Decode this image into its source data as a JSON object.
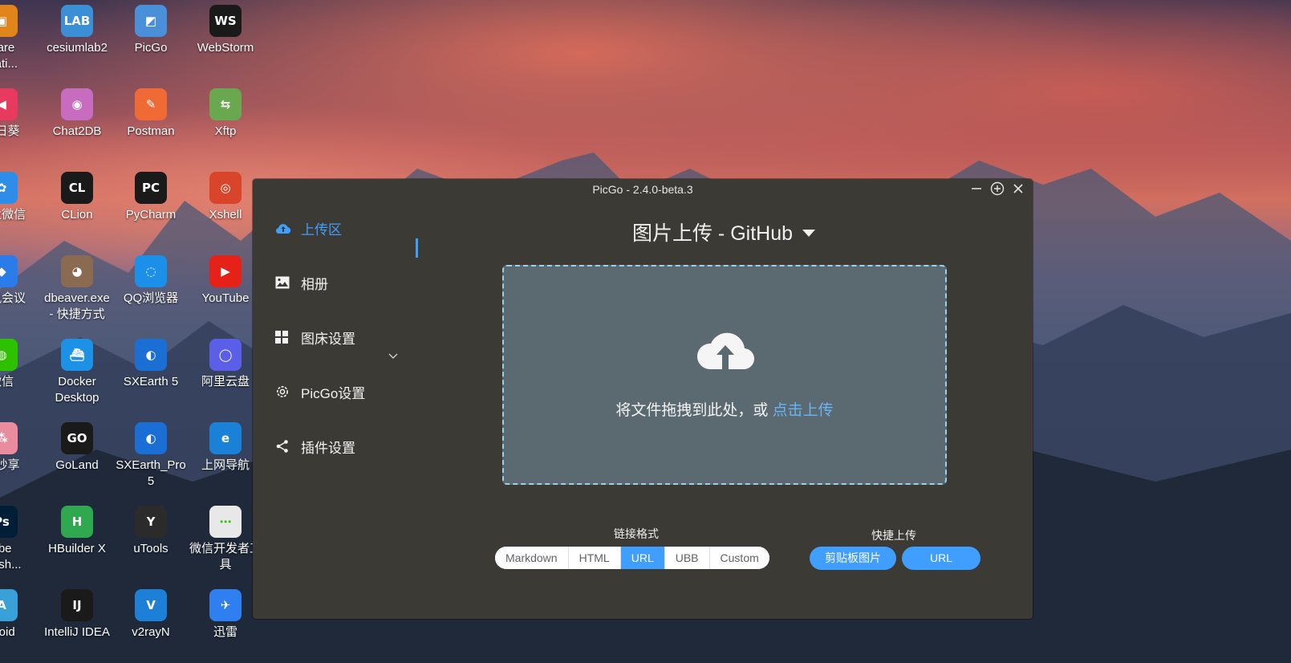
{
  "desktop": {
    "icons": [
      {
        "label": "ware\nstati...",
        "name": "vmware-workstation",
        "color": "#e0841c",
        "glyph": "▣"
      },
      {
        "label": "cesiumlab2",
        "name": "cesiumlab2",
        "color": "#3b8fd6",
        "glyph": "LAB"
      },
      {
        "label": "PicGo",
        "name": "picgo",
        "color": "#4a90d9",
        "glyph": "◩"
      },
      {
        "label": "WebStorm",
        "name": "webstorm",
        "color": "#1a1a1a",
        "glyph": "WS"
      },
      {
        "label": "向日葵",
        "name": "sunlogin",
        "color": "#e83a5f",
        "glyph": "◀"
      },
      {
        "label": "Chat2DB",
        "name": "chat2db",
        "color": "#c86cc0",
        "glyph": "◉"
      },
      {
        "label": "Postman",
        "name": "postman",
        "color": "#f06a35",
        "glyph": "✎"
      },
      {
        "label": "Xftp",
        "name": "xftp",
        "color": "#6aa84f",
        "glyph": "⇆"
      },
      {
        "label": "企业微信",
        "name": "wecom",
        "color": "#2e8de8",
        "glyph": "✿"
      },
      {
        "label": "CLion",
        "name": "clion",
        "color": "#1a1a1a",
        "glyph": "CL"
      },
      {
        "label": "PyCharm",
        "name": "pycharm",
        "color": "#1a1a1a",
        "glyph": "PC"
      },
      {
        "label": "Xshell",
        "name": "xshell",
        "color": "#d9452b",
        "glyph": "◎"
      },
      {
        "label": "腾讯会议",
        "name": "tencent-meeting",
        "color": "#2b7be8",
        "glyph": "◆"
      },
      {
        "label": "dbeaver.exe\n- 快捷方式",
        "name": "dbeaver",
        "color": "#8a6b52",
        "glyph": "◕"
      },
      {
        "label": "QQ浏览器",
        "name": "qq-browser",
        "color": "#1c8fe8",
        "glyph": "◌"
      },
      {
        "label": "YouTube",
        "name": "youtube",
        "color": "#e62117",
        "glyph": "▶"
      },
      {
        "label": "微信",
        "name": "wechat",
        "color": "#2dc100",
        "glyph": "◍"
      },
      {
        "label": "Docker\nDesktop",
        "name": "docker-desktop",
        "color": "#1d91e6",
        "glyph": "⛴"
      },
      {
        "label": "SXEarth 5",
        "name": "sxearth-5",
        "color": "#1b6fd4",
        "glyph": "◐"
      },
      {
        "label": "阿里云盘",
        "name": "aliyun-drive",
        "color": "#5b5fe8",
        "glyph": "◯"
      },
      {
        "label": "米妙享",
        "name": "mi-share",
        "color": "#e98ca0",
        "glyph": "⁂"
      },
      {
        "label": "GoLand",
        "name": "goland",
        "color": "#1a1a1a",
        "glyph": "GO"
      },
      {
        "label": "SXEarth_Pro\n5",
        "name": "sxearth-pro-5",
        "color": "#1b6fd4",
        "glyph": "◐"
      },
      {
        "label": "上网导航",
        "name": "web-nav",
        "color": "#1a82d6",
        "glyph": "e"
      },
      {
        "label": "obe\notosh...",
        "name": "photoshop",
        "color": "#001e36",
        "glyph": "Ps"
      },
      {
        "label": "HBuilder X",
        "name": "hbuilder-x",
        "color": "#2fa84f",
        "glyph": "H"
      },
      {
        "label": "uTools",
        "name": "utools",
        "color": "#2b2b2b",
        "glyph": "Y"
      },
      {
        "label": "微信开发者工\n具",
        "name": "wechat-devtools",
        "color": "#e8e8e8",
        "glyph": "⋯"
      },
      {
        "label": "droid",
        "name": "android-studio",
        "color": "#3aa0d8",
        "glyph": "A"
      },
      {
        "label": "IntelliJ IDEA",
        "name": "intellij-idea",
        "color": "#1a1a1a",
        "glyph": "IJ"
      },
      {
        "label": "v2rayN",
        "name": "v2rayn",
        "color": "#1d7fd6",
        "glyph": "V"
      },
      {
        "label": "迅雷",
        "name": "xunlei",
        "color": "#2f7ff0",
        "glyph": "✈"
      }
    ]
  },
  "window": {
    "title": "PicGo - 2.4.0-beta.3",
    "sidebar": {
      "upload": "上传区",
      "gallery": "相册",
      "pic_bed_settings": "图床设置",
      "picgo_settings": "PicGo设置",
      "plugin_settings": "插件设置"
    },
    "main": {
      "title": "图片上传 - GitHub",
      "drop_text": "将文件拖拽到此处，或 ",
      "drop_link": "点击上传",
      "link_format_label": "链接格式",
      "link_formats": [
        "Markdown",
        "HTML",
        "URL",
        "UBB",
        "Custom"
      ],
      "selected_format": "URL",
      "quick_upload_label": "快捷上传",
      "clipboard_button": "剪贴板图片",
      "url_button": "URL"
    }
  },
  "colors": {
    "accent": "#409eff",
    "window_bg": "#3b3a35",
    "dropzone_bg": "#5b6970"
  }
}
